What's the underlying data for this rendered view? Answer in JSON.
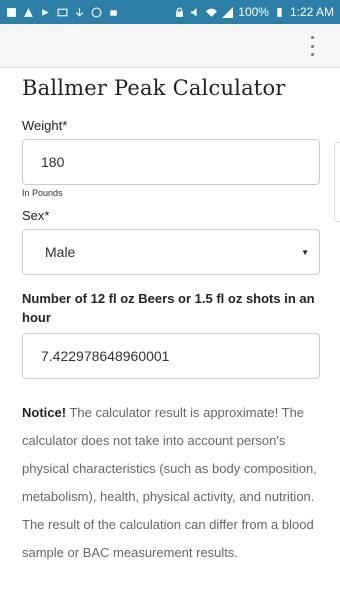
{
  "status_bar": {
    "battery": "100%",
    "time": "1:22 AM"
  },
  "app_bar": {
    "menu_icon": "more-vert-icon"
  },
  "page": {
    "title": "Ballmer Peak Calculator"
  },
  "form": {
    "weight_label": "Weight*",
    "weight_value": "180",
    "weight_hint": "In Pounds",
    "sex_label": "Sex*",
    "sex_value": "Male",
    "drinks_label": "Number of 12 fl oz Beers or 1.5 fl oz shots in an hour",
    "drinks_value": "7.422978648960001"
  },
  "notice": {
    "bold": "Notice!",
    "text": " The calculator result is approximate! The calculator does not take into account person's physical characteristics (such as body composition, metabolism), health, physical activity, and nutrition. The result of the calculation can differ from a blood sample or BAC measurement results."
  }
}
